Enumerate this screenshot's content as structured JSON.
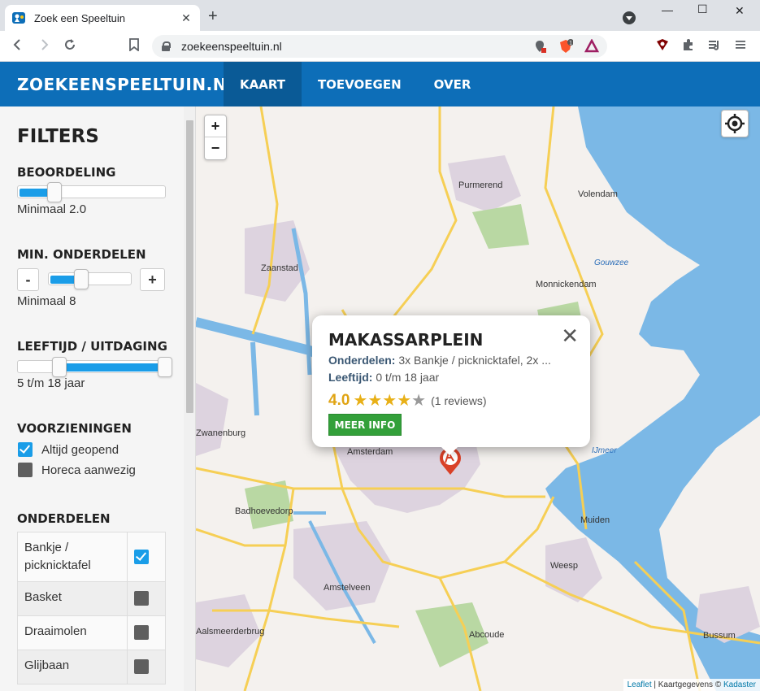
{
  "browser": {
    "tab_title": "Zoek een Speeltuin",
    "tab_close": "✕",
    "new_tab": "+",
    "url": "zoekeenspeeltuin.nl",
    "minimize": "—",
    "maximize": "☐",
    "close": "✕",
    "brave_badge": "1"
  },
  "site": {
    "brand": "ZOEKEENSPEELTUIN.NL",
    "nav": [
      "KAART",
      "TOEVOEGEN",
      "OVER"
    ]
  },
  "sidebar": {
    "title": "FILTERS",
    "rating": {
      "heading": "BEOORDELING",
      "value_text": "Minimaal 2.0",
      "value": 2.0
    },
    "min_parts": {
      "heading": "MIN. ONDERDELEN",
      "minus": "-",
      "plus": "+",
      "value_text": "Minimaal 8",
      "value": 8
    },
    "age": {
      "heading": "LEEFTIJD / UITDAGING",
      "value_text": "5 t/m 18 jaar",
      "min": 5,
      "max": 18
    },
    "facilities": {
      "heading": "VOORZIENINGEN",
      "items": [
        {
          "label": "Altijd geopend",
          "checked": true
        },
        {
          "label": "Horeca aanwezig",
          "checked": false
        }
      ]
    },
    "parts": {
      "heading": "ONDERDELEN",
      "items": [
        {
          "label": "Bankje / picknicktafel",
          "checked": true
        },
        {
          "label": "Basket",
          "checked": false
        },
        {
          "label": "Draaimolen",
          "checked": false
        },
        {
          "label": "Glijbaan",
          "checked": false
        }
      ]
    }
  },
  "map": {
    "zoom_in": "+",
    "zoom_out": "−",
    "places": [
      "Purmerend",
      "Volendam",
      "Zaanstad",
      "Monnickendam",
      "Zwanenburg",
      "Amsterdam",
      "Badhoevedorp",
      "Muiden",
      "Weesp",
      "Amstelveen",
      "Abcoude",
      "Aalsmeerderbrug",
      "Bussum"
    ],
    "water_labels": [
      "Gouwzee",
      "IJmeer"
    ],
    "attribution": {
      "leaflet": "Leaflet",
      "sep": " | Kaartgegevens © ",
      "kadaster": "Kadaster"
    },
    "popup": {
      "title": "MAKASSARPLEIN",
      "parts_label": "Onderdelen:",
      "parts_value": "3x Bankje / picknicktafel, 2x ...",
      "age_label": "Leeftijd:",
      "age_value": "0 t/m 18 jaar",
      "score": "4.0",
      "stars": 4,
      "reviews": "(1 reviews)",
      "button": "MEER INFO",
      "close": "✕"
    },
    "colors": {
      "water": "#7bb8e6",
      "land": "#f4f1ee",
      "urban": "#ddd3df",
      "road": "#f6cf55",
      "green": "#b9d8a3"
    }
  }
}
